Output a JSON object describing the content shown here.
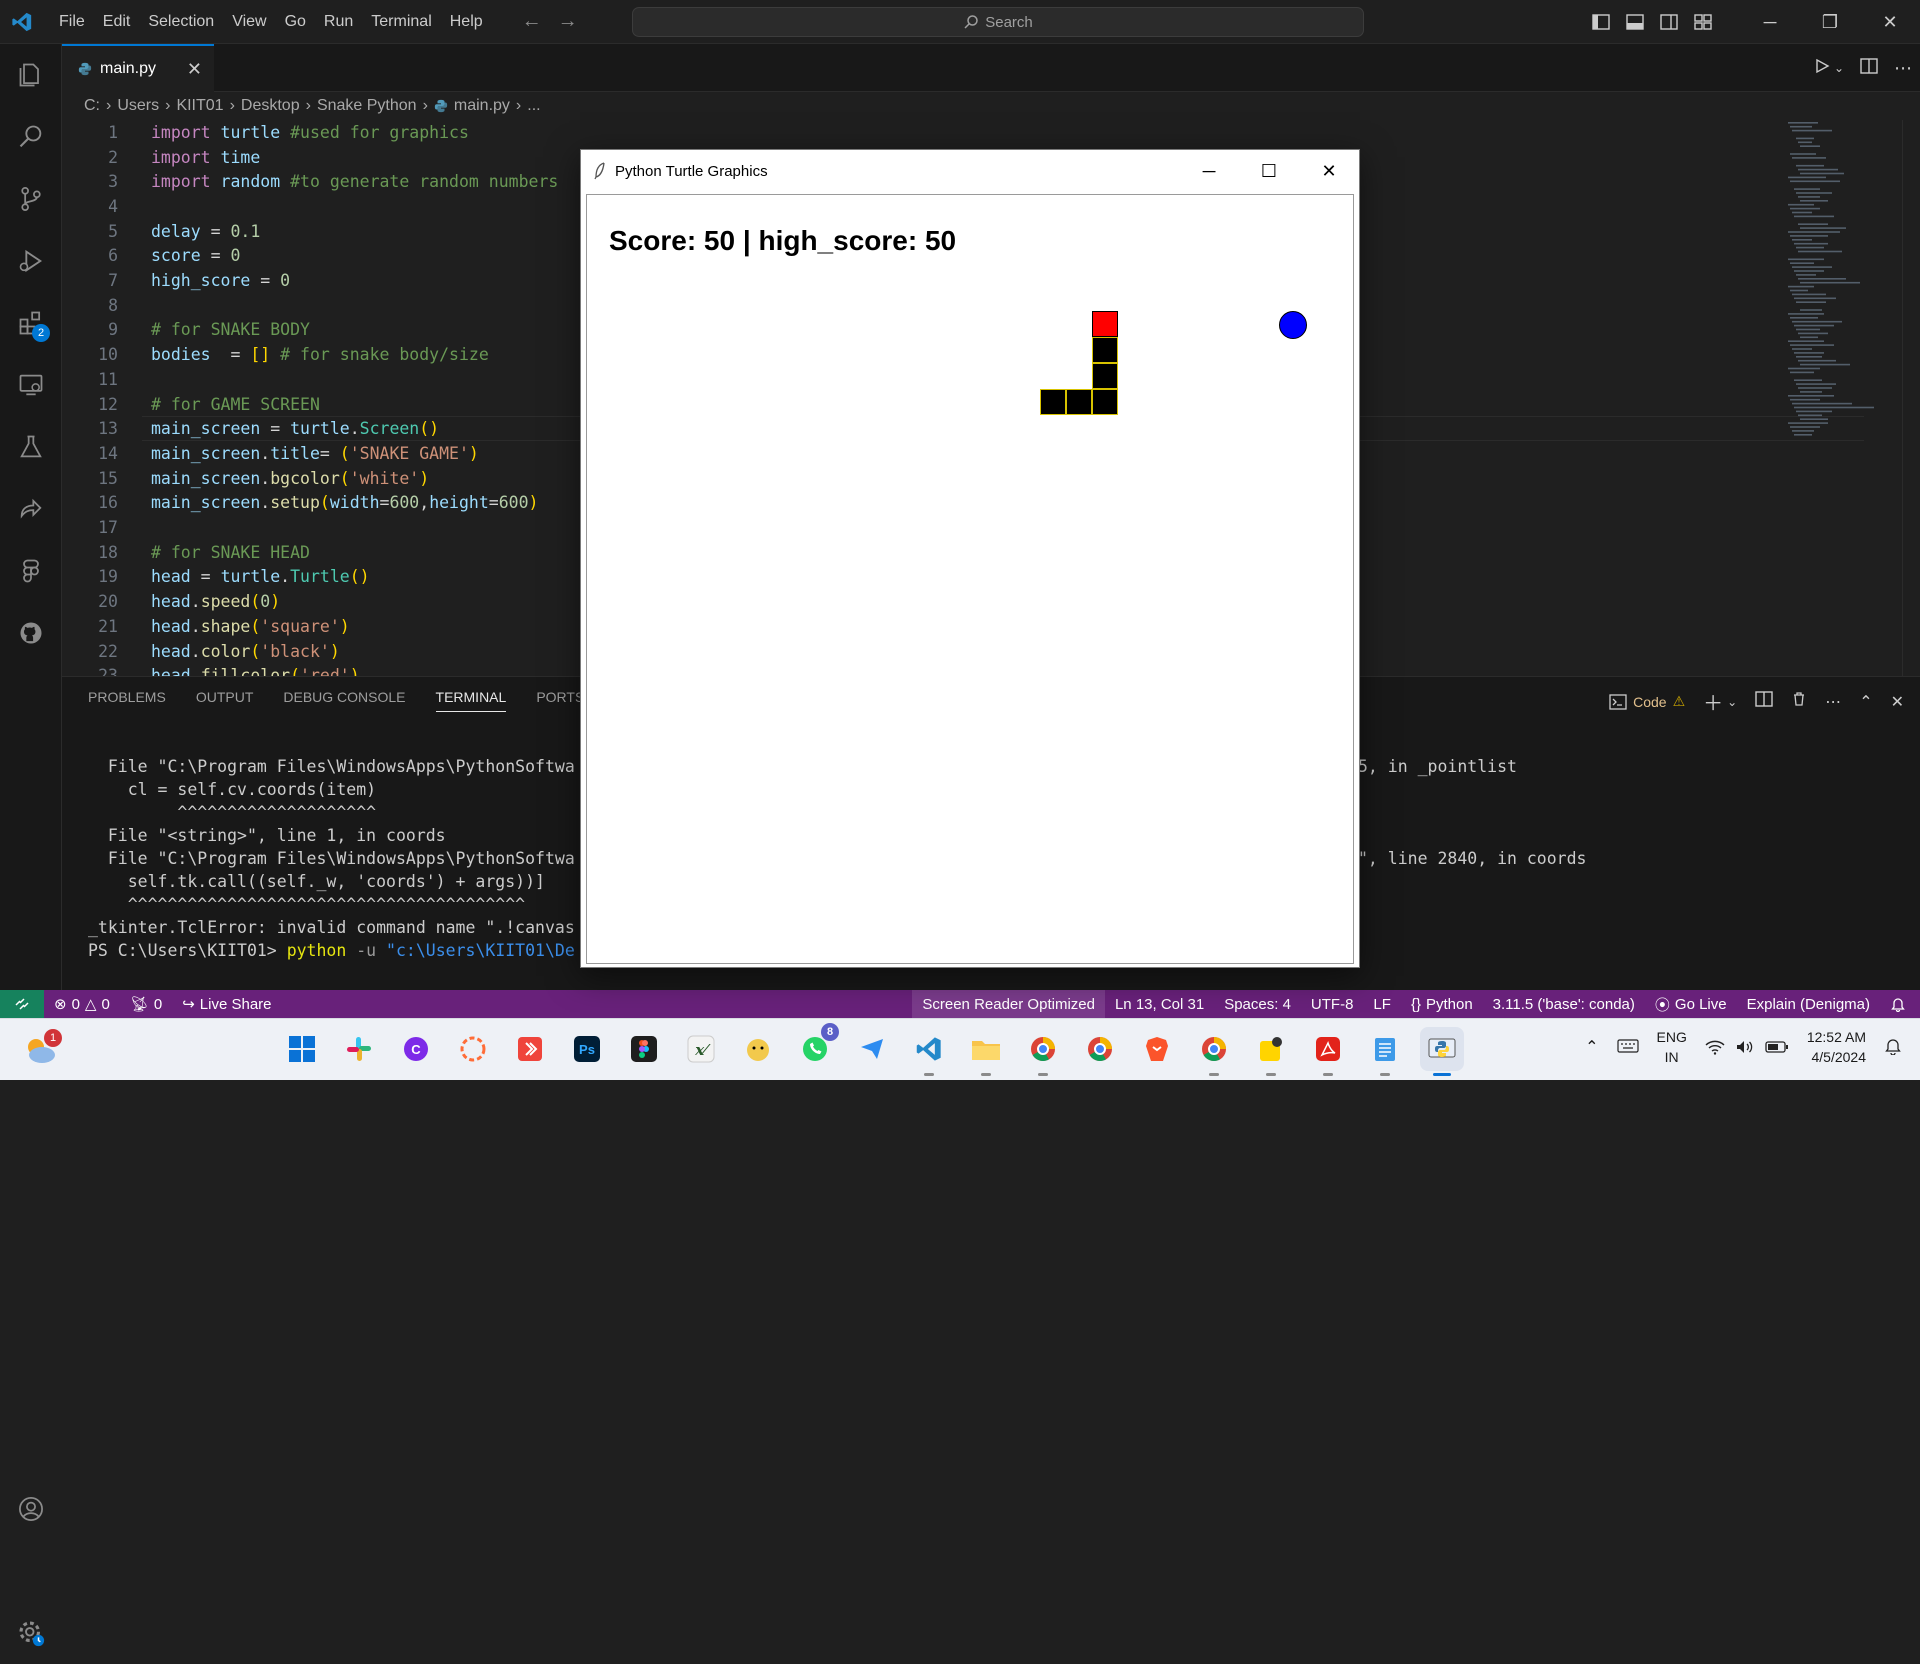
{
  "titlebar": {
    "menu": [
      "File",
      "Edit",
      "Selection",
      "View",
      "Go",
      "Run",
      "Terminal",
      "Help"
    ],
    "search_placeholder": "Search"
  },
  "activity": {
    "extensions_badge": "2"
  },
  "tab": {
    "name": "main.py"
  },
  "breadcrumb": [
    "C:",
    "Users",
    "KIIT01",
    "Desktop",
    "Snake Python",
    "main.py",
    "..."
  ],
  "editor": {
    "line_numbers": [
      "1",
      "2",
      "3",
      "4",
      "5",
      "6",
      "7",
      "8",
      "9",
      "10",
      "11",
      "12",
      "13",
      "14",
      "15",
      "16",
      "17",
      "18",
      "19",
      "20",
      "21",
      "22",
      "23"
    ],
    "lines": [
      [
        [
          "kw",
          "import"
        ],
        [
          "op",
          " "
        ],
        [
          "id",
          "turtle"
        ],
        [
          "op",
          " "
        ],
        [
          "cm",
          "#used for graphics"
        ]
      ],
      [
        [
          "kw",
          "import"
        ],
        [
          "op",
          " "
        ],
        [
          "id",
          "time"
        ]
      ],
      [
        [
          "kw",
          "import"
        ],
        [
          "op",
          " "
        ],
        [
          "id",
          "random"
        ],
        [
          "op",
          " "
        ],
        [
          "cm",
          "#to generate random numbers"
        ]
      ],
      [],
      [
        [
          "id",
          "delay"
        ],
        [
          "op",
          " = "
        ],
        [
          "nm",
          "0.1"
        ]
      ],
      [
        [
          "id",
          "score"
        ],
        [
          "op",
          " = "
        ],
        [
          "nm",
          "0"
        ]
      ],
      [
        [
          "id",
          "high_score"
        ],
        [
          "op",
          " = "
        ],
        [
          "nm",
          "0"
        ]
      ],
      [],
      [
        [
          "cm",
          "# for SNAKE BODY"
        ]
      ],
      [
        [
          "id",
          "bodies"
        ],
        [
          "op",
          "  = "
        ],
        [
          "br",
          "[]"
        ],
        [
          "op",
          " "
        ],
        [
          "cm",
          "# for snake body/size"
        ]
      ],
      [],
      [
        [
          "cm",
          "# for GAME SCREEN"
        ]
      ],
      [
        [
          "id",
          "main_screen"
        ],
        [
          "op",
          " = "
        ],
        [
          "id",
          "turtle"
        ],
        [
          "op",
          "."
        ],
        [
          "cl",
          "Screen"
        ],
        [
          "br",
          "()"
        ]
      ],
      [
        [
          "id",
          "main_screen"
        ],
        [
          "op",
          "."
        ],
        [
          "id",
          "title"
        ],
        [
          "op",
          "= "
        ],
        [
          "br",
          "("
        ],
        [
          "st",
          "'SNAKE GAME'"
        ],
        [
          "br",
          ")"
        ]
      ],
      [
        [
          "id",
          "main_screen"
        ],
        [
          "op",
          "."
        ],
        [
          "fn",
          "bgcolor"
        ],
        [
          "br",
          "("
        ],
        [
          "st",
          "'white'"
        ],
        [
          "br",
          ")"
        ]
      ],
      [
        [
          "id",
          "main_screen"
        ],
        [
          "op",
          "."
        ],
        [
          "fn",
          "setup"
        ],
        [
          "br",
          "("
        ],
        [
          "id",
          "width"
        ],
        [
          "op",
          "="
        ],
        [
          "nm",
          "600"
        ],
        [
          "op",
          ","
        ],
        [
          "id",
          "height"
        ],
        [
          "op",
          "="
        ],
        [
          "nm",
          "600"
        ],
        [
          "br",
          ")"
        ]
      ],
      [],
      [
        [
          "cm",
          "# for SNAKE HEAD"
        ]
      ],
      [
        [
          "id",
          "head"
        ],
        [
          "op",
          " = "
        ],
        [
          "id",
          "turtle"
        ],
        [
          "op",
          "."
        ],
        [
          "cl",
          "Turtle"
        ],
        [
          "br",
          "()"
        ]
      ],
      [
        [
          "id",
          "head"
        ],
        [
          "op",
          "."
        ],
        [
          "fn",
          "speed"
        ],
        [
          "br",
          "("
        ],
        [
          "nm",
          "0"
        ],
        [
          "br",
          ")"
        ]
      ],
      [
        [
          "id",
          "head"
        ],
        [
          "op",
          "."
        ],
        [
          "fn",
          "shape"
        ],
        [
          "br",
          "("
        ],
        [
          "st",
          "'square'"
        ],
        [
          "br",
          ")"
        ]
      ],
      [
        [
          "id",
          "head"
        ],
        [
          "op",
          "."
        ],
        [
          "fn",
          "color"
        ],
        [
          "br",
          "("
        ],
        [
          "st",
          "'black'"
        ],
        [
          "br",
          ")"
        ]
      ],
      [
        [
          "id",
          "head"
        ],
        [
          "op",
          "."
        ],
        [
          "fn",
          "fillcolor"
        ],
        [
          "br",
          "("
        ],
        [
          "st",
          "'red'"
        ],
        [
          "br",
          ")"
        ]
      ]
    ]
  },
  "panel": {
    "tabs": [
      "PROBLEMS",
      "OUTPUT",
      "DEBUG CONSOLE",
      "TERMINAL",
      "PORTS"
    ],
    "active_tab": "TERMINAL",
    "profile_label": "Code",
    "terminal_left": [
      "  File \"C:\\Program Files\\WindowsApps\\PythonSoftwa",
      "    cl = self.cv.coords(item)",
      "         ^^^^^^^^^^^^^^^^^^^^",
      "  File \"<string>\", line 1, in coords",
      "  File \"C:\\Program Files\\WindowsApps\\PythonSoftwa",
      "    self.tk.call((self._w, 'coords') + args))]",
      "    ^^^^^^^^^^^^^^^^^^^^^^^^^^^^^^^^^^^^^^^^",
      "_tkinter.TclError: invalid command name \".!canvas"
    ],
    "prompt": "PS C:\\Users\\KIIT01> ",
    "cmd": "python",
    "cmd_flag": " -u ",
    "cmd_path": "\"c:\\Users\\KIIT01\\De",
    "terminal_right_1": "5, in _pointlist",
    "terminal_right_2": "\", line 2840, in coords"
  },
  "turtle_window": {
    "title": "Python Turtle Graphics",
    "score_text": "Score: 50 | high_score: 50"
  },
  "status": {
    "errors": "0",
    "warnings": "0",
    "ports": "0",
    "live_share": "Live Share",
    "screen_reader": "Screen Reader Optimized",
    "position": "Ln 13, Col 31",
    "spaces": "Spaces: 4",
    "encoding": "UTF-8",
    "eol": "LF",
    "language": "Python",
    "interpreter": "3.11.5 ('base': conda)",
    "go_live": "Go Live",
    "explain": "Explain (Denigma)"
  },
  "taskbar": {
    "weather_badge": "1",
    "whatsapp_badge": "8",
    "lang_line1": "ENG",
    "lang_line2": "IN",
    "time": "12:52 AM",
    "date": "4/5/2024"
  },
  "colors": {
    "accent": "#0078d4",
    "statusbar": "#68217a",
    "snake_head": "#ff0000",
    "food": "#0000ff"
  }
}
